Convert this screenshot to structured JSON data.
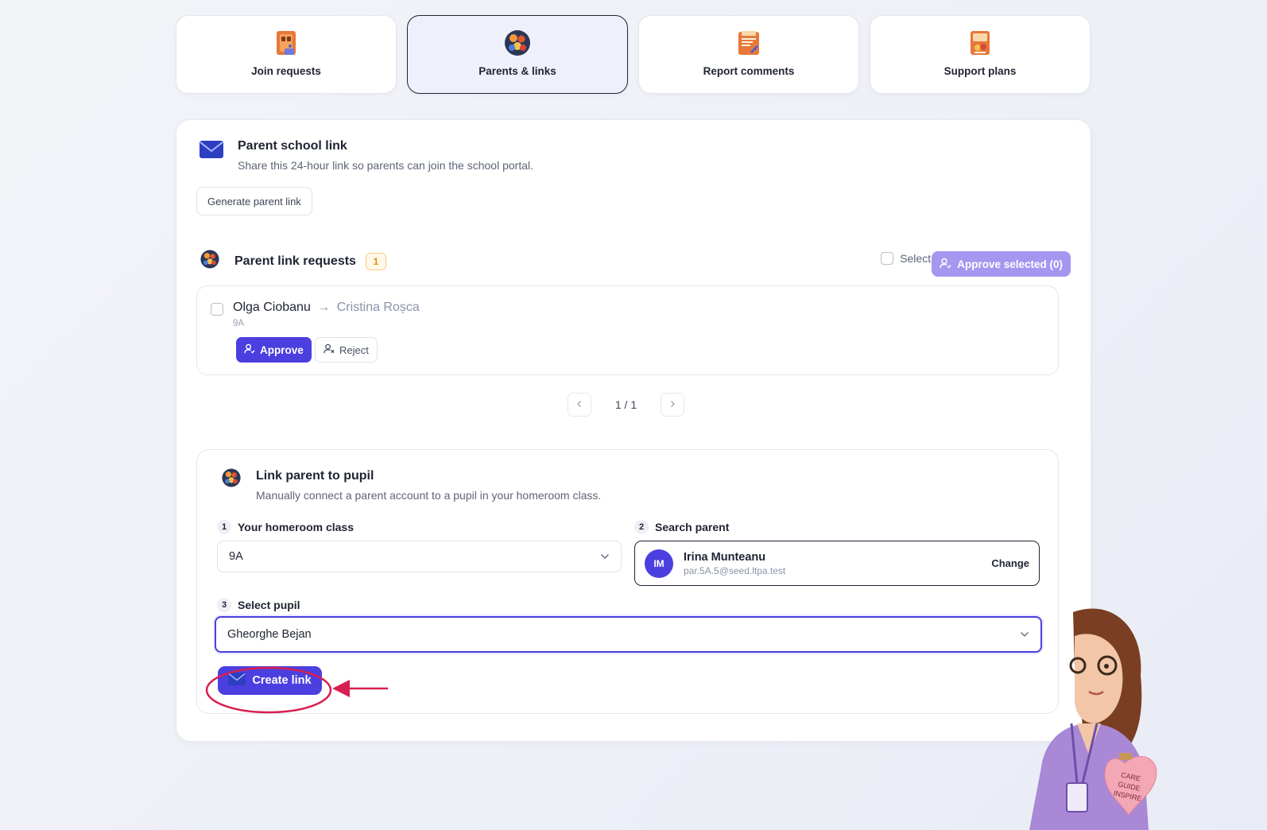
{
  "tabs": [
    {
      "label": "Join requests",
      "icon": "door-icon"
    },
    {
      "label": "Parents & links",
      "icon": "family-icon",
      "active": true
    },
    {
      "label": "Report comments",
      "icon": "report-icon"
    },
    {
      "label": "Support plans",
      "icon": "support-plan-icon"
    }
  ],
  "school_link": {
    "title": "Parent school link",
    "subtitle": "Share this 24-hour link so parents can join the school portal.",
    "generate_label": "Generate parent link"
  },
  "requests": {
    "title": "Parent link requests",
    "count": "1",
    "select_all_label": "Select all",
    "approve_selected_label": "Approve selected (0)",
    "items": [
      {
        "parent": "Olga Ciobanu",
        "arrow": "→",
        "pupil": "Cristina Roșca",
        "class": "9A",
        "approve_label": "Approve",
        "reject_label": "Reject"
      }
    ],
    "pager": "1 / 1"
  },
  "link_parent": {
    "title": "Link parent to pupil",
    "subtitle": "Manually connect a parent account to a pupil in your homeroom class.",
    "step1": {
      "num": "1",
      "label": "Your homeroom class",
      "value": "9A"
    },
    "step2": {
      "num": "2",
      "label": "Search parent",
      "initials": "IM",
      "name": "Irina Munteanu",
      "email": "par.5A.5@seed.ltpa.test",
      "change_label": "Change"
    },
    "step3": {
      "num": "3",
      "label": "Select pupil",
      "value": "Gheorghe Bejan"
    },
    "create_label": "Create link"
  },
  "mascot": {
    "heart_text": [
      "CARE",
      "GUIDE",
      "INSPIRE"
    ]
  },
  "colors": {
    "accent": "#4b3fe0",
    "accent_muted": "#a596f0",
    "badge": "#f5a623",
    "annotation": "#d81f4f"
  }
}
